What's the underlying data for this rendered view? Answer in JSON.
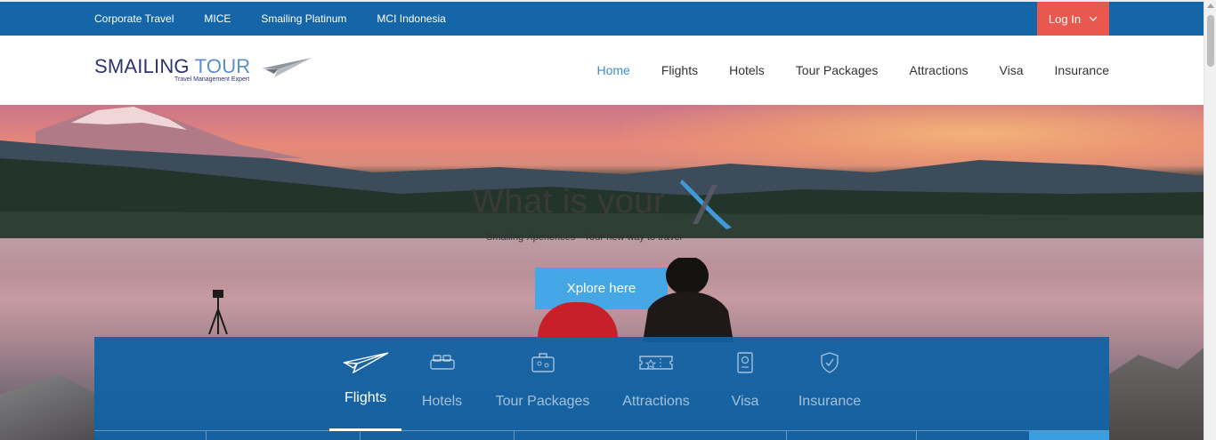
{
  "topbar": {
    "links": [
      "Corporate Travel",
      "MICE",
      "Smailing Platinum",
      "MCI Indonesia"
    ],
    "login_label": "Log In",
    "colors": {
      "bar": "#1466a8",
      "login": "#e9584f"
    }
  },
  "header": {
    "logo": {
      "name": "SMAILING",
      "name2": "TOUR",
      "tagline": "Travel Management Expert"
    },
    "nav": [
      {
        "label": "Home",
        "active": true
      },
      {
        "label": "Flights"
      },
      {
        "label": "Hotels"
      },
      {
        "label": "Tour Packages"
      },
      {
        "label": "Attractions"
      },
      {
        "label": "Visa"
      },
      {
        "label": "Insurance"
      }
    ]
  },
  "hero": {
    "title": "What is your",
    "subtitle": "Smailing Xperiences - Your new way to travel",
    "cta_label": "Xplore here",
    "accent": "#45a7e6"
  },
  "search_tabs": [
    {
      "label": "Flights",
      "icon": "paper-plane-icon",
      "active": true
    },
    {
      "label": "Hotels",
      "icon": "bed-icon"
    },
    {
      "label": "Tour Packages",
      "icon": "suitcase-icon"
    },
    {
      "label": "Attractions",
      "icon": "ticket-icon"
    },
    {
      "label": "Visa",
      "icon": "passport-icon"
    },
    {
      "label": "Insurance",
      "icon": "shield-check-icon"
    }
  ]
}
